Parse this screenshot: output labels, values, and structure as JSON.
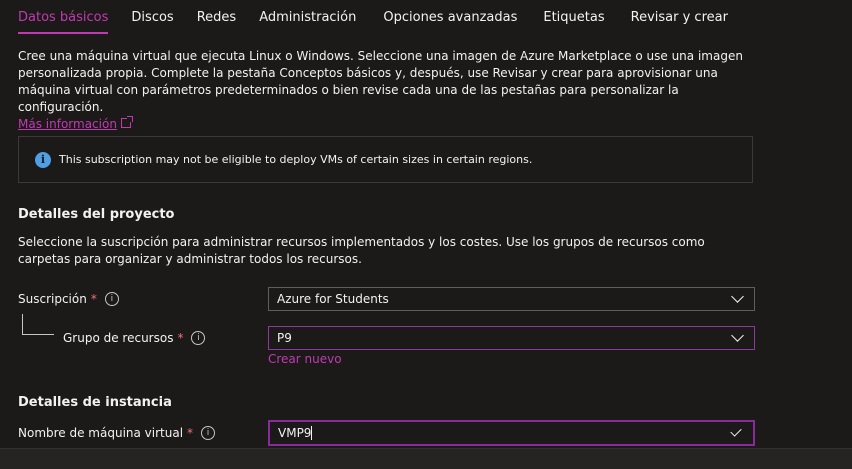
{
  "tabs": [
    {
      "label": "Datos básicos",
      "active": true
    },
    {
      "label": "Discos"
    },
    {
      "label": "Redes"
    },
    {
      "label": "Administración"
    },
    {
      "label": "Opciones avanzadas"
    },
    {
      "label": "Etiquetas"
    },
    {
      "label": "Revisar y crear"
    }
  ],
  "intro": {
    "text": "Cree una máquina virtual que ejecuta Linux o Windows. Seleccione una imagen de Azure Marketplace o use una imagen personalizada propia. Complete la pestaña Conceptos básicos y, después, use Revisar y crear para aprovisionar una máquina virtual con parámetros predeterminados o bien revise cada una de las pestañas para personalizar la configuración.",
    "link": "Más información"
  },
  "info_banner": {
    "icon": "info-icon",
    "text": "This subscription may not be eligible to deploy VMs of certain sizes in certain regions."
  },
  "project": {
    "title": "Detalles del proyecto",
    "description": "Seleccione la suscripción para administrar recursos implementados y los costes. Use los grupos de recursos como carpetas para organizar y administrar todos los recursos.",
    "subscription": {
      "label": "Suscripción",
      "required": "*",
      "value": "Azure for Students"
    },
    "resource_group": {
      "label": "Grupo de recursos",
      "required": "*",
      "value": "P9",
      "create_new": "Crear nuevo"
    }
  },
  "instance": {
    "title": "Detalles de instancia",
    "vm_name": {
      "label": "Nombre de máquina virtual",
      "required": "*",
      "value": "VMP9"
    }
  },
  "colors": {
    "accent": "#c239b3",
    "background": "#1b1a19",
    "info": "#4f9fe5",
    "required": "#f1707b"
  }
}
